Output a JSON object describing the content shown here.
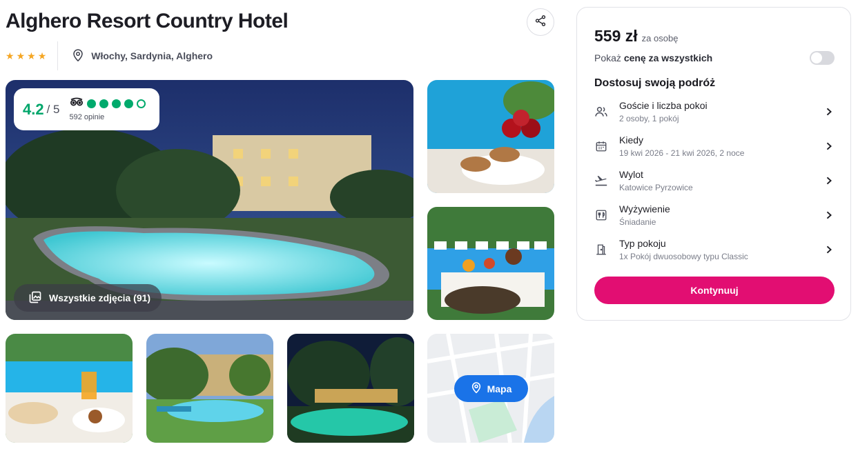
{
  "hotel": {
    "name": "Alghero Resort Country Hotel",
    "stars": 4,
    "location": "Włochy, Sardynia, Alghero"
  },
  "rating": {
    "score": "4.2",
    "of": "/ 5",
    "reviews": "592 opinie",
    "bubbles_filled": 4,
    "bubbles_total": 5,
    "color": "#00aa6c"
  },
  "gallery": {
    "all_photos_label": "Wszystkie zdjęcia (91)",
    "map_label": "Mapa"
  },
  "booking": {
    "price": "559 zł",
    "price_unit": "za osobę",
    "toggle_prefix": "Pokaż ",
    "toggle_bold": "cenę za wszystkich",
    "toggle_on": false,
    "section_title": "Dostosuj swoją podróż",
    "options": [
      {
        "label": "Goście i liczba pokoi",
        "value": "2 osoby, 1 pokój",
        "icon": "guests-icon"
      },
      {
        "label": "Kiedy",
        "value": "19 kwi 2026 - 21 kwi 2026, 2 noce",
        "icon": "calendar-icon"
      },
      {
        "label": "Wylot",
        "value": "Katowice Pyrzowice",
        "icon": "plane-departure-icon"
      },
      {
        "label": "Wyżywienie",
        "value": "Śniadanie",
        "icon": "meal-icon"
      },
      {
        "label": "Typ pokoju",
        "value": "1x Pokój dwuosobowy typu Classic",
        "icon": "door-icon"
      }
    ],
    "continue_label": "Kontynuuj",
    "accent_color": "#e20e72"
  }
}
